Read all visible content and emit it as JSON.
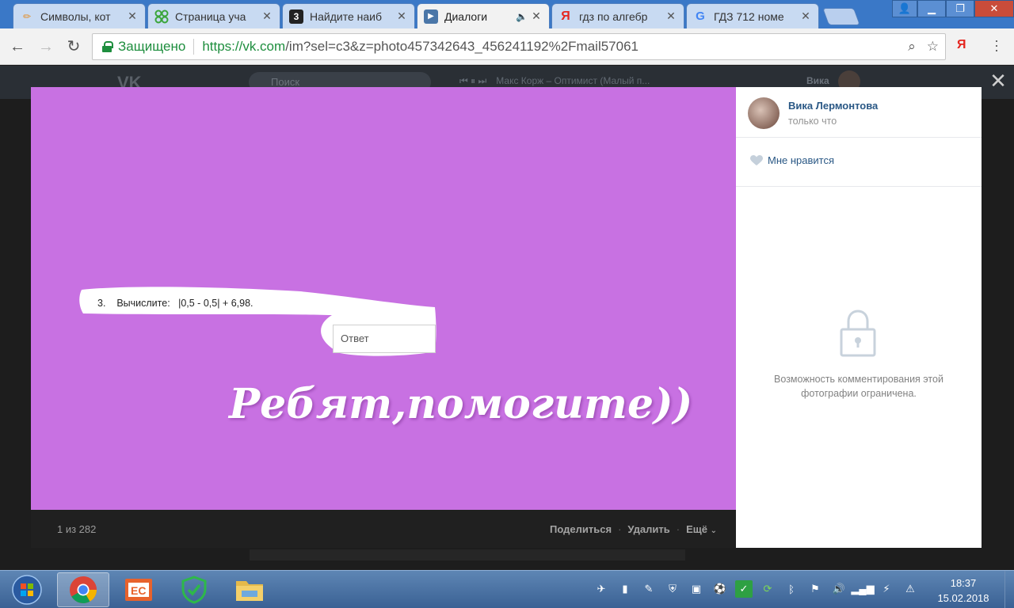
{
  "browser": {
    "tabs": [
      {
        "icon": "pencil-icon",
        "title": "Символы, кот",
        "active": false
      },
      {
        "icon": "grid-icon",
        "title": "Страница уча",
        "active": false
      },
      {
        "icon": "znanija-icon",
        "title": "Найдите наиб",
        "active": false
      },
      {
        "icon": "vk-dialog-icon",
        "title": "Диалоги",
        "active": true
      },
      {
        "icon": "yandex-icon",
        "title": "гдз по алгебр",
        "active": false
      },
      {
        "icon": "gdz-icon",
        "title": "ГДЗ 712 номе",
        "active": false
      }
    ],
    "secure_label": "Защищено",
    "url_host": "https://vk.com",
    "url_path": "/im?sel=c3&z=photo457342643_456241192%2Fmail57061"
  },
  "vk_header": {
    "search_placeholder": "Поиск",
    "now_playing": "Макс Корж – Оптимист (Малый п...",
    "user_name": "Вика"
  },
  "photo": {
    "bg_color": "#c871e2",
    "question": "3.    Вычислите:   |0,5 - 0,5| + 6,98.",
    "answer_placeholder": "Ответ",
    "caption": "Ребят,помогите))"
  },
  "viewer_bottom": {
    "counter": "1 из 282",
    "share": "Поделиться",
    "delete": "Удалить",
    "more": "Ещё"
  },
  "sidebar": {
    "author_name": "Вика Лермонтова",
    "author_time": "только что",
    "like_label": "Мне нравится",
    "restricted_text": "Возможность комментирования этой фотографии ограничена."
  },
  "taskbar": {
    "apps": [
      "chrome-icon",
      "presentation-icon",
      "shield-check-icon",
      "file-explorer-icon"
    ],
    "time": "18:37",
    "date": "15.02.2018"
  }
}
